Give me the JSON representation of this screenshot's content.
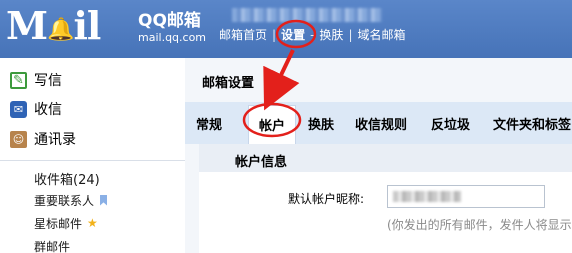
{
  "header": {
    "logo_text": "Mil",
    "brand_cn": "QQ邮箱",
    "brand_sub": "mail.qq.com",
    "nav": [
      {
        "label": "邮箱首页"
      },
      {
        "label": "设置"
      },
      {
        "label": "换肤"
      },
      {
        "label": "域名邮箱"
      }
    ],
    "separator": "|",
    "separator_dash": "-",
    "background": "#4f7cc0"
  },
  "sidebar": {
    "actions": [
      {
        "label": "写信",
        "icon": "compose-icon"
      },
      {
        "label": "收信",
        "icon": "inbox-icon"
      },
      {
        "label": "通讯录",
        "icon": "contacts-icon"
      }
    ],
    "folders": [
      {
        "label": "收件箱(24)"
      },
      {
        "label": "重要联系人",
        "icon": "flag-icon"
      },
      {
        "label": "星标邮件",
        "icon": "star-icon"
      },
      {
        "label": "群邮件"
      }
    ]
  },
  "main": {
    "title": "邮箱设置",
    "tabs": [
      {
        "label": "常规"
      },
      {
        "label": "帐户",
        "active": true
      },
      {
        "label": "换肤"
      },
      {
        "label": "收信规则"
      },
      {
        "label": "反垃圾"
      },
      {
        "label": "文件夹和标签"
      }
    ],
    "section_title": "帐户信息",
    "nickname_label": "默认帐户昵称:",
    "nickname_hint": "(你发出的所有邮件，发件人将显示"
  },
  "annotation": {
    "color": "#e3201b"
  }
}
